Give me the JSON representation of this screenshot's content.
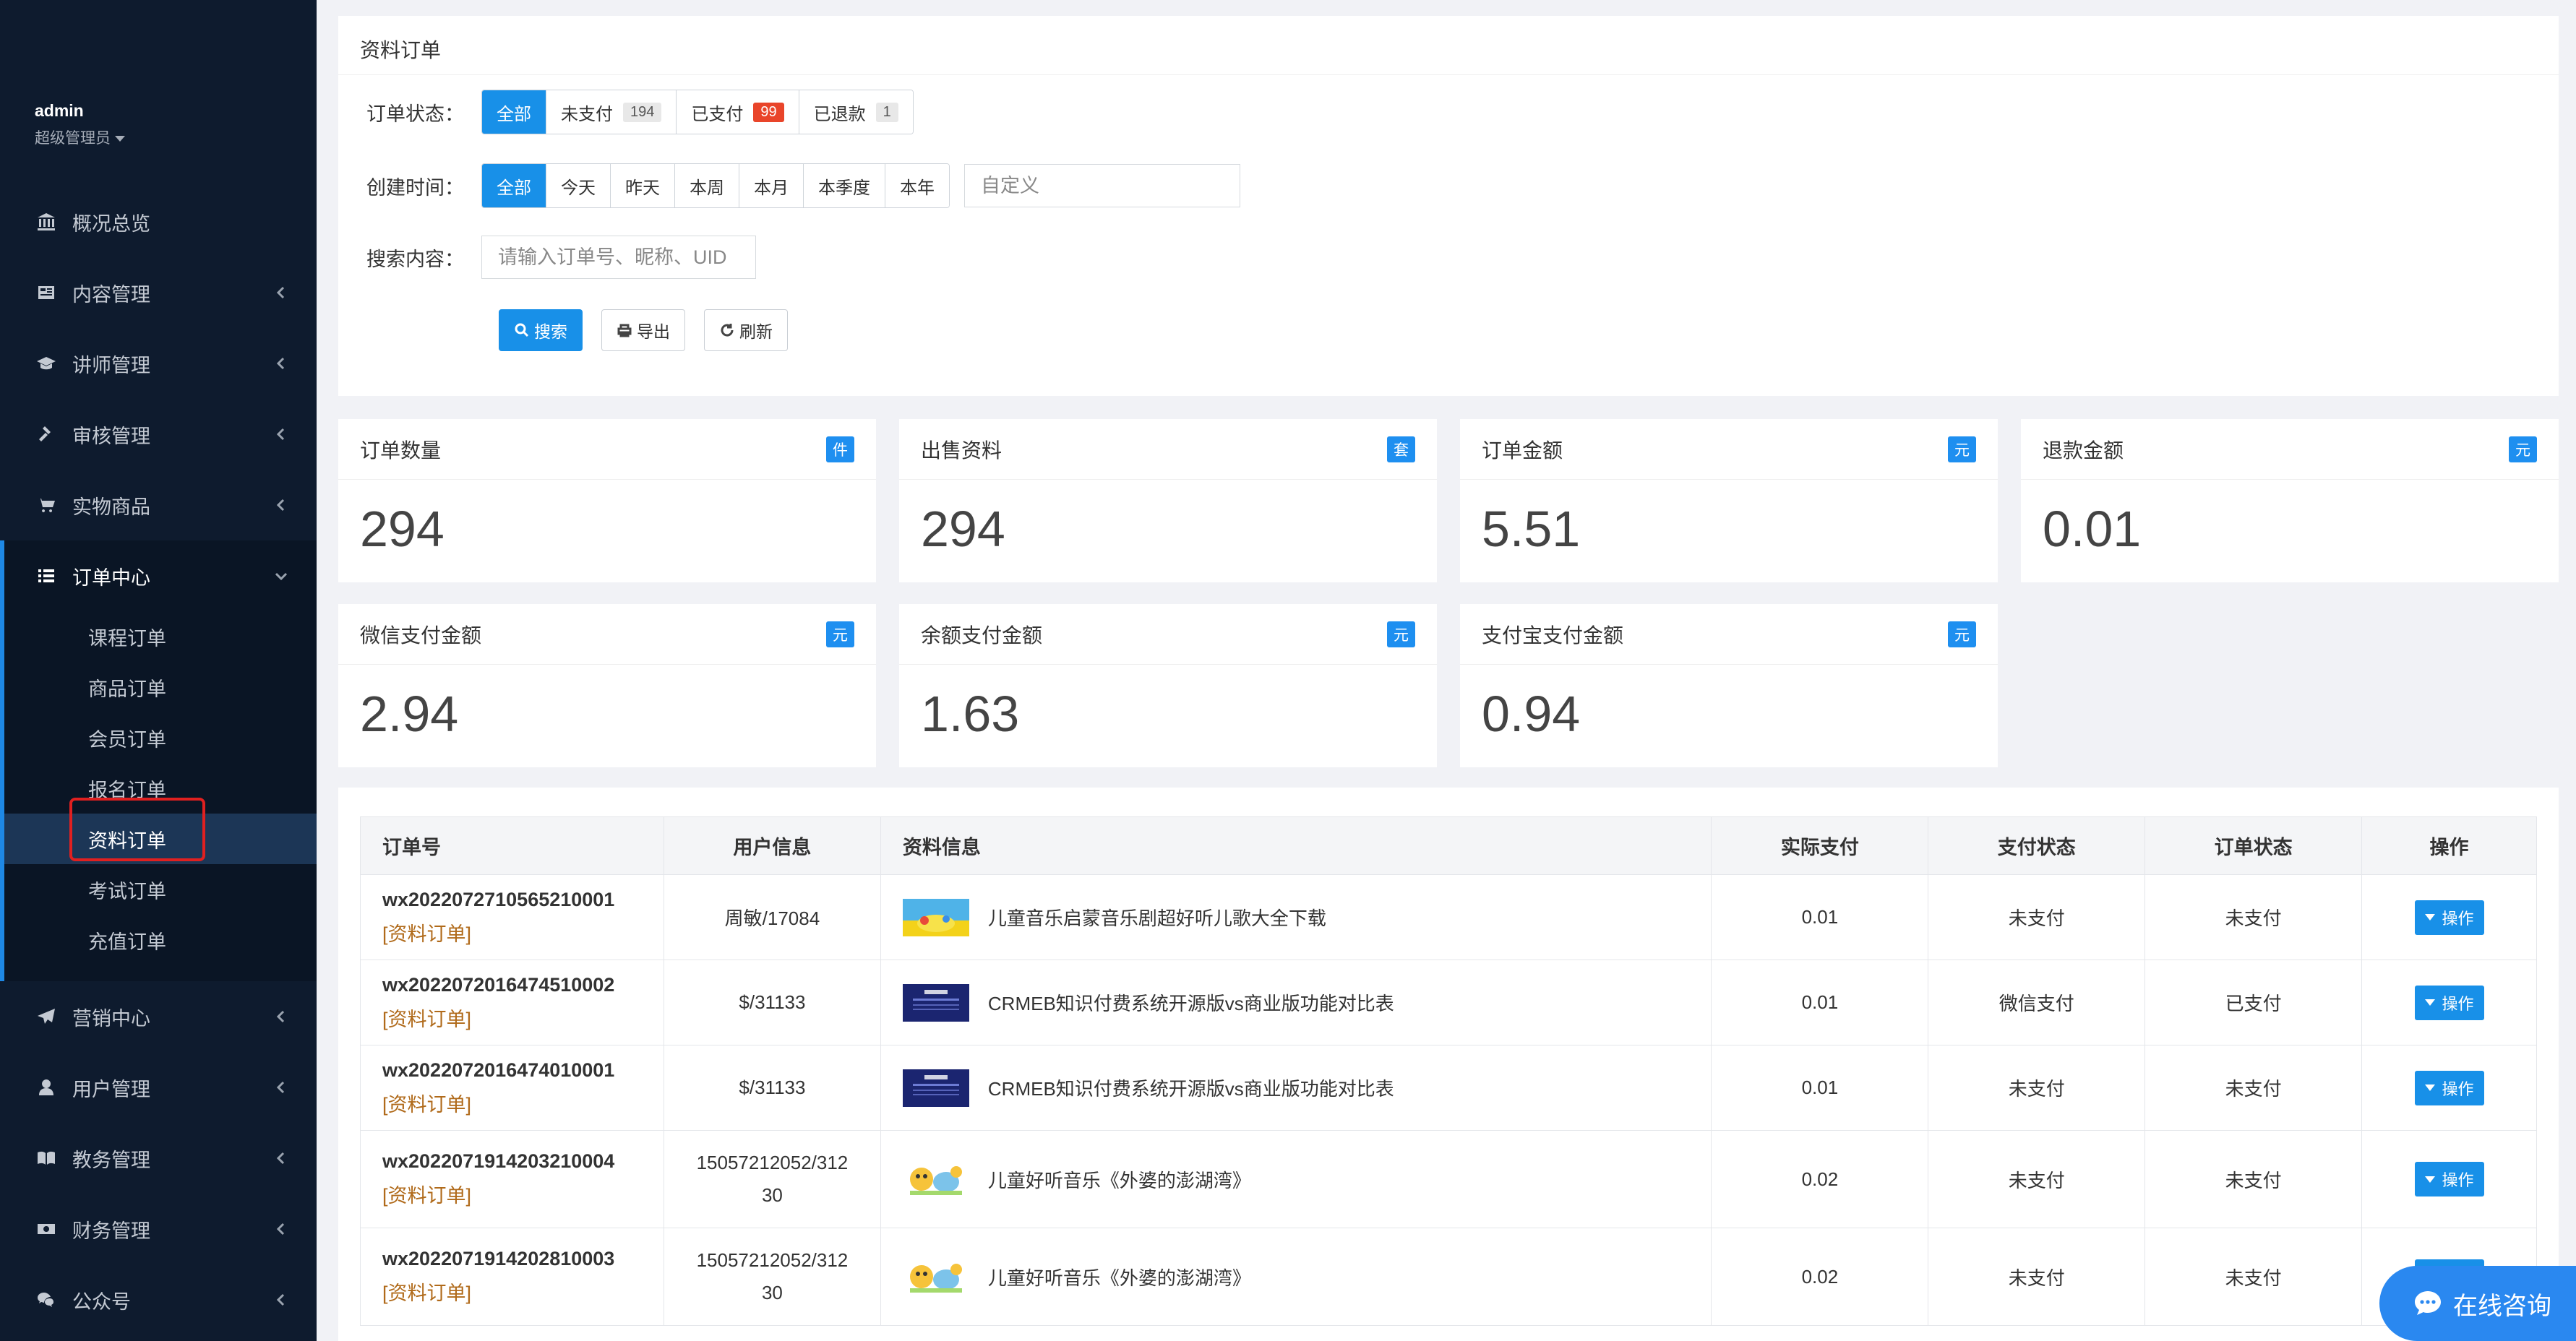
{
  "sidebar": {
    "user": {
      "name": "admin",
      "role": "超级管理员"
    },
    "items": [
      {
        "label": "概况总览",
        "icon": "bank-icon"
      },
      {
        "label": "内容管理",
        "icon": "newspaper-icon"
      },
      {
        "label": "讲师管理",
        "icon": "graduation-cap-icon"
      },
      {
        "label": "审核管理",
        "icon": "gavel-icon"
      },
      {
        "label": "实物商品",
        "icon": "cart-icon"
      }
    ],
    "order_center": {
      "label": "订单中心",
      "icon": "list-icon",
      "sub_items": [
        "课程订单",
        "商品订单",
        "会员订单",
        "报名订单",
        "资料订单",
        "考试订单",
        "充值订单"
      ],
      "active_index": 4
    },
    "items_after": [
      {
        "label": "营销中心",
        "icon": "paper-plane-icon"
      },
      {
        "label": "用户管理",
        "icon": "user-icon"
      },
      {
        "label": "教务管理",
        "icon": "book-icon"
      },
      {
        "label": "财务管理",
        "icon": "money-icon"
      },
      {
        "label": "公众号",
        "icon": "wechat-icon"
      }
    ]
  },
  "filter": {
    "title": "资料订单",
    "status_label": "订单状态：",
    "status_options": [
      {
        "label": "全部",
        "count": ""
      },
      {
        "label": "未支付",
        "count": "194"
      },
      {
        "label": "已支付",
        "count": "99"
      },
      {
        "label": "已退款",
        "count": "1"
      }
    ],
    "time_label": "创建时间：",
    "time_options": [
      "全部",
      "今天",
      "昨天",
      "本周",
      "本月",
      "本季度",
      "本年"
    ],
    "custom_placeholder": "自定义",
    "search_label": "搜索内容：",
    "search_placeholder": "请输入订单号、昵称、UID",
    "search_btn": "搜索",
    "export_btn": "导出",
    "refresh_btn": "刷新"
  },
  "stats": [
    {
      "title": "订单数量",
      "tag": "件",
      "value": "294"
    },
    {
      "title": "出售资料",
      "tag": "套",
      "value": "294"
    },
    {
      "title": "订单金额",
      "tag": "元",
      "value": "5.51"
    },
    {
      "title": "退款金额",
      "tag": "元",
      "value": "0.01"
    },
    {
      "title": "微信支付金额",
      "tag": "元",
      "value": "2.94"
    },
    {
      "title": "余额支付金额",
      "tag": "元",
      "value": "1.63"
    },
    {
      "title": "支付宝支付金额",
      "tag": "元",
      "value": "0.94"
    }
  ],
  "table": {
    "headers": [
      "订单号",
      "用户信息",
      "资料信息",
      "实际支付",
      "支付状态",
      "订单状态",
      "操作"
    ],
    "op_label": "操作",
    "rows": [
      {
        "order_no": "wx2022072710565210001",
        "tag": "[资料订单]",
        "user": "周敏/17084",
        "user2": "",
        "doc": "儿童音乐启蒙音乐剧超好听儿歌大全下载",
        "thumb": "yellow",
        "paid": "0.01",
        "pay_status": "未支付",
        "order_status": "未支付"
      },
      {
        "order_no": "wx2022072016474510002",
        "tag": "[资料订单]",
        "user": "$/31133",
        "user2": "",
        "doc": "CRMEB知识付费系统开源版vs商业版功能对比表",
        "thumb": "navy",
        "paid": "0.01",
        "pay_status": "微信支付",
        "order_status": "已支付"
      },
      {
        "order_no": "wx2022072016474010001",
        "tag": "[资料订单]",
        "user": "$/31133",
        "user2": "",
        "doc": "CRMEB知识付费系统开源版vs商业版功能对比表",
        "thumb": "navy",
        "paid": "0.01",
        "pay_status": "未支付",
        "order_status": "未支付"
      },
      {
        "order_no": "wx2022071914203210004",
        "tag": "[资料订单]",
        "user": "15057212052/312",
        "user2": "30",
        "doc": "儿童好听音乐《外婆的澎湖湾》",
        "thumb": "cartoon",
        "paid": "0.02",
        "pay_status": "未支付",
        "order_status": "未支付"
      },
      {
        "order_no": "wx2022071914202810003",
        "tag": "[资料订单]",
        "user": "15057212052/312",
        "user2": "30",
        "doc": "儿童好听音乐《外婆的澎湖湾》",
        "thumb": "cartoon",
        "paid": "0.02",
        "pay_status": "未支付",
        "order_status": "未支付"
      }
    ]
  },
  "chat": {
    "label": "在线咨询",
    "icon": "chat-bubble-icon"
  },
  "colors": {
    "sidebar_bg": "#0e1b2e",
    "primary": "#1890e8",
    "badge_red": "#e9452a",
    "tag_brown": "#b06a1a"
  }
}
